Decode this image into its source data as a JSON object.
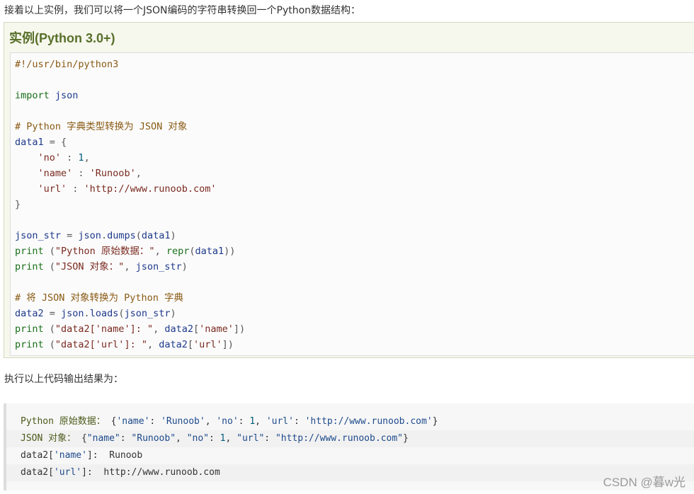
{
  "intro_text": "接着以上实例，我们可以将一个JSON编码的字符串转换回一个Python数据结构：",
  "example": {
    "title": "实例(Python 3.0+)",
    "code_lines": [
      [
        {
          "t": "#!/usr/bin/python3",
          "c": "comment"
        }
      ],
      [],
      [
        {
          "t": "import",
          "c": "kw"
        },
        {
          "t": " json",
          "c": "name"
        }
      ],
      [],
      [
        {
          "t": "# Python 字典类型转换为 JSON 对象",
          "c": "comment"
        }
      ],
      [
        {
          "t": "data1",
          "c": "name"
        },
        {
          "t": " = {",
          "c": "op"
        }
      ],
      [
        {
          "t": "    'no'",
          "c": "str"
        },
        {
          "t": " : ",
          "c": "op"
        },
        {
          "t": "1",
          "c": "num"
        },
        {
          "t": ",",
          "c": "op"
        }
      ],
      [
        {
          "t": "    'name'",
          "c": "str"
        },
        {
          "t": " : ",
          "c": "op"
        },
        {
          "t": "'Runoob'",
          "c": "str"
        },
        {
          "t": ",",
          "c": "op"
        }
      ],
      [
        {
          "t": "    'url'",
          "c": "str"
        },
        {
          "t": " : ",
          "c": "op"
        },
        {
          "t": "'http://www.runoob.com'",
          "c": "str"
        }
      ],
      [
        {
          "t": "}",
          "c": "op"
        }
      ],
      [],
      [
        {
          "t": "json_str",
          "c": "name"
        },
        {
          "t": " = ",
          "c": "op"
        },
        {
          "t": "json",
          "c": "name"
        },
        {
          "t": ".",
          "c": "op"
        },
        {
          "t": "dumps",
          "c": "fn"
        },
        {
          "t": "(",
          "c": "op"
        },
        {
          "t": "data1",
          "c": "name"
        },
        {
          "t": ")",
          "c": "op"
        }
      ],
      [
        {
          "t": "print",
          "c": "kw"
        },
        {
          "t": " (",
          "c": "op"
        },
        {
          "t": "\"Python 原始数据：\"",
          "c": "str"
        },
        {
          "t": ", ",
          "c": "op"
        },
        {
          "t": "repr",
          "c": "kw"
        },
        {
          "t": "(",
          "c": "op"
        },
        {
          "t": "data1",
          "c": "name"
        },
        {
          "t": "))",
          "c": "op"
        }
      ],
      [
        {
          "t": "print",
          "c": "kw"
        },
        {
          "t": " (",
          "c": "op"
        },
        {
          "t": "\"JSON 对象：\"",
          "c": "str"
        },
        {
          "t": ", ",
          "c": "op"
        },
        {
          "t": "json_str",
          "c": "name"
        },
        {
          "t": ")",
          "c": "op"
        }
      ],
      [],
      [
        {
          "t": "# 将 JSON 对象转换为 Python 字典",
          "c": "comment"
        }
      ],
      [
        {
          "t": "data2",
          "c": "name"
        },
        {
          "t": " = ",
          "c": "op"
        },
        {
          "t": "json",
          "c": "name"
        },
        {
          "t": ".",
          "c": "op"
        },
        {
          "t": "loads",
          "c": "fn"
        },
        {
          "t": "(",
          "c": "op"
        },
        {
          "t": "json_str",
          "c": "name"
        },
        {
          "t": ")",
          "c": "op"
        }
      ],
      [
        {
          "t": "print",
          "c": "kw"
        },
        {
          "t": " (",
          "c": "op"
        },
        {
          "t": "\"data2['name']: \"",
          "c": "str"
        },
        {
          "t": ", ",
          "c": "op"
        },
        {
          "t": "data2",
          "c": "name"
        },
        {
          "t": "[",
          "c": "op"
        },
        {
          "t": "'name'",
          "c": "str"
        },
        {
          "t": "])",
          "c": "op"
        }
      ],
      [
        {
          "t": "print",
          "c": "kw"
        },
        {
          "t": " (",
          "c": "op"
        },
        {
          "t": "\"data2['url']: \"",
          "c": "str"
        },
        {
          "t": ", ",
          "c": "op"
        },
        {
          "t": "data2",
          "c": "name"
        },
        {
          "t": "[",
          "c": "op"
        },
        {
          "t": "'url'",
          "c": "str"
        },
        {
          "t": "])",
          "c": "op"
        }
      ]
    ]
  },
  "output_intro": "执行以上代码输出结果为：",
  "output_lines": [
    [
      {
        "t": "Python 原始数据： ",
        "c": "key"
      },
      {
        "t": "{",
        "c": "plain"
      },
      {
        "t": "'name'",
        "c": "str"
      },
      {
        "t": ": ",
        "c": "plain"
      },
      {
        "t": "'Runoob'",
        "c": "str"
      },
      {
        "t": ", ",
        "c": "plain"
      },
      {
        "t": "'no'",
        "c": "str"
      },
      {
        "t": ": ",
        "c": "plain"
      },
      {
        "t": "1",
        "c": "num"
      },
      {
        "t": ", ",
        "c": "plain"
      },
      {
        "t": "'url'",
        "c": "str"
      },
      {
        "t": ": ",
        "c": "plain"
      },
      {
        "t": "'http://www.runoob.com'",
        "c": "str"
      },
      {
        "t": "}",
        "c": "plain"
      }
    ],
    [
      {
        "t": "JSON 对象： ",
        "c": "key"
      },
      {
        "t": "{",
        "c": "plain"
      },
      {
        "t": "\"name\"",
        "c": "str"
      },
      {
        "t": ": ",
        "c": "plain"
      },
      {
        "t": "\"Runoob\"",
        "c": "str"
      },
      {
        "t": ", ",
        "c": "plain"
      },
      {
        "t": "\"no\"",
        "c": "str"
      },
      {
        "t": ": ",
        "c": "plain"
      },
      {
        "t": "1",
        "c": "num"
      },
      {
        "t": ", ",
        "c": "plain"
      },
      {
        "t": "\"url\"",
        "c": "str"
      },
      {
        "t": ": ",
        "c": "plain"
      },
      {
        "t": "\"http://www.runoob.com\"",
        "c": "str"
      },
      {
        "t": "}",
        "c": "plain"
      }
    ],
    [
      {
        "t": "data2[",
        "c": "plain"
      },
      {
        "t": "'name'",
        "c": "str"
      },
      {
        "t": "]:  Runoob",
        "c": "plain"
      }
    ],
    [
      {
        "t": "data2[",
        "c": "plain"
      },
      {
        "t": "'url'",
        "c": "str"
      },
      {
        "t": "]:  http://www.runoob.com",
        "c": "plain"
      }
    ]
  ],
  "watermark": "CSDN @暮w光"
}
